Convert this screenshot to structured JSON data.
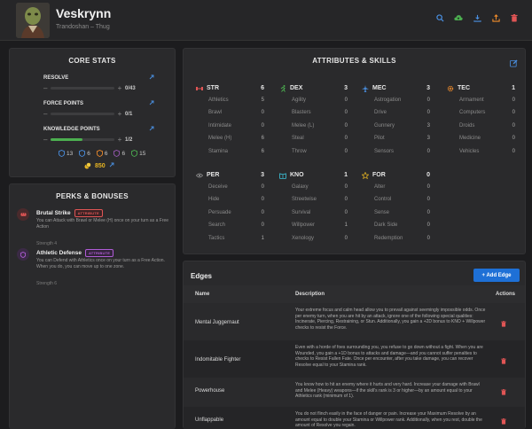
{
  "character": {
    "name": "Veskrynn",
    "subtitle": "Trandoshan – Thug"
  },
  "header_icons": [
    "search-icon",
    "cloud-upload-icon",
    "download-icon",
    "export-icon",
    "trash-icon"
  ],
  "core_stats": {
    "title": "CORE STATS",
    "resources": [
      {
        "label": "RESOLVE",
        "value": "0/43",
        "fill": 0
      },
      {
        "label": "FORCE POINTS",
        "value": "0/1",
        "fill": 0
      },
      {
        "label": "KNOWLEDGE POINTS",
        "value": "1/2",
        "fill": 0.5
      }
    ],
    "counters": [
      {
        "icon": "shield-icon",
        "value": "13",
        "color": "#4a90e2"
      },
      {
        "icon": "shield-icon",
        "value": "6",
        "color": "#4a90e2"
      },
      {
        "icon": "shield-icon",
        "value": "6",
        "color": "#f08c2b"
      },
      {
        "icon": "shield-icon",
        "value": "6",
        "color": "#9b59b6"
      },
      {
        "icon": "shield-icon",
        "value": "15",
        "color": "#4caf50"
      }
    ],
    "credits": "850"
  },
  "perks": {
    "title": "PERKS & BONUSES",
    "items": [
      {
        "name": "Brutal Strike",
        "badge": "ATTRIBUTE",
        "desc": "You can Attack with Brawl or Melee (H) once on your turn as a Free Action",
        "sub": "Strength 4",
        "color": "#e05555"
      },
      {
        "name": "Athletic Defense",
        "badge": "ATTRIBUTE",
        "desc": "You can Defend with Athletics once on your turn as a Free Action. When you do, you can move up to one zone.",
        "sub": "Strength 6",
        "color": "#b05cd6"
      }
    ]
  },
  "attributes": {
    "title": "ATTRIBUTES & SKILLS",
    "groups": [
      {
        "abbr": "STR",
        "value": "6",
        "color": "#e05555",
        "icon": "dumbbell-icon",
        "skills": [
          [
            "Athletics",
            "5"
          ],
          [
            "Brawl",
            "0"
          ],
          [
            "Intimidate",
            "0"
          ],
          [
            "Melee (H)",
            "6"
          ],
          [
            "Stamina",
            "6"
          ]
        ]
      },
      {
        "abbr": "DEX",
        "value": "3",
        "color": "#4caf50",
        "icon": "running-icon",
        "skills": [
          [
            "Agility",
            "0"
          ],
          [
            "Blasters",
            "0"
          ],
          [
            "Melee (L)",
            "0"
          ],
          [
            "Steal",
            "0"
          ],
          [
            "Throw",
            "0"
          ]
        ]
      },
      {
        "abbr": "MEC",
        "value": "3",
        "color": "#4a90e2",
        "icon": "plane-icon",
        "skills": [
          [
            "Astrogation",
            "0"
          ],
          [
            "Drive",
            "0"
          ],
          [
            "Gunnery",
            "3"
          ],
          [
            "Pilot",
            "3"
          ],
          [
            "Sensors",
            "0"
          ]
        ]
      },
      {
        "abbr": "TEC",
        "value": "1",
        "color": "#f08c2b",
        "icon": "gear-icon",
        "skills": [
          [
            "Armament",
            "0"
          ],
          [
            "Computers",
            "0"
          ],
          [
            "Droids",
            "0"
          ],
          [
            "Medicine",
            "0"
          ],
          [
            "Vehicles",
            "0"
          ]
        ]
      },
      {
        "abbr": "PER",
        "value": "3",
        "color": "#9a9a9a",
        "icon": "eye-icon",
        "skills": [
          [
            "Deceive",
            "0"
          ],
          [
            "Hide",
            "0"
          ],
          [
            "Persuade",
            "0"
          ],
          [
            "Search",
            "0"
          ],
          [
            "Tactics",
            "1"
          ]
        ]
      },
      {
        "abbr": "KNO",
        "value": "1",
        "color": "#3bb3c8",
        "icon": "book-icon",
        "skills": [
          [
            "Galaxy",
            "0"
          ],
          [
            "Streetwise",
            "0"
          ],
          [
            "Survival",
            "0"
          ],
          [
            "Willpower",
            "1"
          ],
          [
            "Xenology",
            "0"
          ]
        ]
      },
      {
        "abbr": "FOR",
        "value": "0",
        "color": "#e6b422",
        "icon": "star-icon",
        "skills": [
          [
            "Alter",
            "0"
          ],
          [
            "Control",
            "0"
          ],
          [
            "Sense",
            "0"
          ],
          [
            "Dark Side",
            "0"
          ],
          [
            "Redemption",
            "0"
          ]
        ]
      }
    ]
  },
  "edges": {
    "title": "Edges",
    "add_label": "+ Add Edge",
    "columns": {
      "name": "Name",
      "description": "Description",
      "actions": "Actions"
    },
    "rows": [
      {
        "name": "Mental Juggernaut",
        "desc": "Your extreme focus and calm head allow you to prevail against seemingly impossible odds. Once per enemy turn, when you are hit by an attack, ignore one of the following special qualities: Incinerate, Piercing, Restraining, or Stun. Additionally, you gain a +2D bonus to KNO + Willpower checks to resist the Force."
      },
      {
        "name": "Indomitable Fighter",
        "desc": "Even with a horde of foes surrounding you, you refuse to go down without a fight. When you are Wounded, you gain a +1D bonus to attacks and damage—and you cannot suffer penalties to checks to Resist Fallen Fate. Once per encounter, after you take damage, you can recover Resolve equal to your Stamina rank."
      },
      {
        "name": "Powerhouse",
        "desc": "You know how to hit an enemy where it hurts and very hard. Increase your damage with Brawl and Melee (Heavy) weapons—if the skill's rank is 3 or higher—by an amount equal to your Athletics rank (minimum of 1)."
      },
      {
        "name": "Unflappable",
        "desc": "You do not flinch easily in the face of danger or pain. Increase your Maximum Resolve by an amount equal to double your Stamina or Willpower rank. Additionally, when you rest, double the amount of Resolve you regain."
      }
    ]
  }
}
